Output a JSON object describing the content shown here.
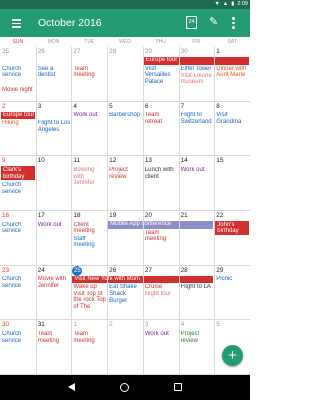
{
  "status_bar": {
    "time": "2:09",
    "battery_icon": "battery-icon",
    "wifi_icon": "wifi-icon",
    "signal_icon": "signal-icon"
  },
  "app_bar": {
    "title": "October 2016",
    "today_date": "24",
    "menu_icon": "menu-icon",
    "add_event_icon": "add-event-icon",
    "more_icon": "more-vert-icon"
  },
  "weekdays": [
    "SUN",
    "MON",
    "TUE",
    "WED",
    "THU",
    "FRI",
    "SAT"
  ],
  "colors": {
    "primary": "#249b74",
    "status": "#1f6b52",
    "red": "#d32f2f",
    "blue": "#1565c0",
    "green": "#2e7d32",
    "purple": "#7b1fa2",
    "orange": "#f4511e",
    "pink": "#e57373",
    "lavender": "#8e8ec9",
    "today": "#1a73c8"
  },
  "weeks": [
    {
      "days": [
        "25",
        "26",
        "27",
        "28",
        "29",
        "30",
        "1"
      ],
      "grey": [
        0,
        1,
        2,
        3,
        4,
        5
      ],
      "bars": [
        {
          "label": "Europe tour",
          "start": 4,
          "span": 3,
          "color": "red"
        }
      ],
      "events": [
        {
          "day": 0,
          "line": 0,
          "text": "Church service",
          "color": "blue"
        },
        {
          "day": 1,
          "line": 0,
          "text": "See a dentist",
          "color": "blue"
        },
        {
          "day": 2,
          "line": 0,
          "text": "Team meeting",
          "color": "red"
        },
        {
          "day": 4,
          "line": 0,
          "text": "Visit Versailles Palace",
          "color": "blue"
        },
        {
          "day": 5,
          "line": 0,
          "text": "Eiffel Tower",
          "color": "blue"
        },
        {
          "day": 5,
          "line": 1,
          "text": "Visit Louvre museum",
          "color": "pink"
        },
        {
          "day": 6,
          "line": 0,
          "text": "Dinner with Aunt Marie",
          "color": "orange"
        },
        {
          "day": 0,
          "line": 2,
          "text": "Movie night",
          "color": "red"
        }
      ]
    },
    {
      "days": [
        "2",
        "3",
        "4",
        "5",
        "6",
        "7",
        "8"
      ],
      "grey": [],
      "bars": [
        {
          "label": "Europe tour",
          "start": 0,
          "span": 1,
          "color": "red"
        }
      ],
      "events": [
        {
          "day": 0,
          "line": 0,
          "text": "Hiking",
          "color": "orange"
        },
        {
          "day": 1,
          "line": 0,
          "text": "Flight to Los Angeles",
          "color": "blue"
        },
        {
          "day": 2,
          "line": -1,
          "text": "Work out",
          "color": "purple"
        },
        {
          "day": 3,
          "line": -1,
          "text": "Barbershop",
          "color": "blue"
        },
        {
          "day": 4,
          "line": -1,
          "text": "Team retreat",
          "color": "red"
        },
        {
          "day": 5,
          "line": -1,
          "text": "Flight to Switzerland",
          "color": "blue"
        },
        {
          "day": 6,
          "line": -1,
          "text": "Visit Grandma",
          "color": "blue"
        }
      ]
    },
    {
      "days": [
        "9",
        "10",
        "11",
        "12",
        "13",
        "14",
        "15"
      ],
      "grey": [],
      "bars": [
        {
          "label": "Clark's birthday",
          "start": 0,
          "span": 1,
          "color": "red",
          "tall": true
        }
      ],
      "events": [
        {
          "day": 0,
          "line": 2,
          "text": "Church service",
          "color": "blue"
        },
        {
          "day": 2,
          "line": -1,
          "text": "Bowling with Jennifer",
          "color": "pink"
        },
        {
          "day": 3,
          "line": -1,
          "text": "Project review",
          "color": "red"
        },
        {
          "day": 4,
          "line": -1,
          "text": "Lunch with client",
          "color": "dark"
        },
        {
          "day": 5,
          "line": -1,
          "text": "Work out",
          "color": "purple"
        }
      ]
    },
    {
      "days": [
        "16",
        "17",
        "18",
        "19",
        "20",
        "21",
        "22"
      ],
      "grey": [],
      "bars": [
        {
          "label": "Mobile App conference",
          "start": 3,
          "span": 3,
          "color": "lavender"
        },
        {
          "label": "John's birthday",
          "start": 6,
          "span": 1,
          "color": "red",
          "tall": true
        }
      ],
      "events": [
        {
          "day": 0,
          "line": -1,
          "text": "Church service",
          "color": "blue"
        },
        {
          "day": 1,
          "line": -1,
          "text": "Work out",
          "color": "purple"
        },
        {
          "day": 2,
          "line": -1,
          "text": "Client meeting",
          "color": "red"
        },
        {
          "day": 2,
          "line": 1,
          "text": "Staff meeting",
          "color": "blue"
        },
        {
          "day": 4,
          "line": 1,
          "text": "Team meeting",
          "color": "red"
        }
      ]
    },
    {
      "days": [
        "23",
        "24",
        "25",
        "26",
        "27",
        "28",
        "29"
      ],
      "grey": [],
      "today_index": 2,
      "bars": [
        {
          "label": "Visit New York with Mom",
          "start": 2,
          "span": 4,
          "color": "red"
        }
      ],
      "events": [
        {
          "day": 0,
          "line": -1,
          "text": "Church service",
          "color": "blue"
        },
        {
          "day": 1,
          "line": -1,
          "text": "Movie with Jennifer",
          "color": "red"
        },
        {
          "day": 2,
          "line": 1,
          "text": "Wake up",
          "color": "red"
        },
        {
          "day": 2,
          "line": 2,
          "text": "Visit Top of the rock Top of The",
          "color": "red"
        },
        {
          "day": 3,
          "line": 1,
          "text": "Eat Shake Shack Burger",
          "color": "blue"
        },
        {
          "day": 4,
          "line": 1,
          "text": "Cruise",
          "color": "red"
        },
        {
          "day": 4,
          "line": 2,
          "text": "Night tour",
          "color": "pink"
        },
        {
          "day": 5,
          "line": 1,
          "text": "Flight to LA",
          "color": "dark"
        },
        {
          "day": 6,
          "line": -1,
          "text": "Picnic",
          "color": "blue"
        }
      ]
    },
    {
      "days": [
        "30",
        "31",
        "1",
        "2",
        "3",
        "4",
        "5"
      ],
      "grey": [
        2,
        3,
        4,
        5,
        6
      ],
      "bars": [],
      "events": [
        {
          "day": 0,
          "line": -1,
          "text": "Church service",
          "color": "blue"
        },
        {
          "day": 1,
          "line": -1,
          "text": "Team meeting",
          "color": "red"
        },
        {
          "day": 2,
          "line": -1,
          "text": "Team meeting",
          "color": "red"
        },
        {
          "day": 4,
          "line": -1,
          "text": "Work out",
          "color": "purple"
        },
        {
          "day": 5,
          "line": -1,
          "text": "Project review",
          "color": "green"
        }
      ]
    }
  ],
  "fab_icon": "plus-icon",
  "nav": {
    "back_icon": "back-icon",
    "home_icon": "home-icon",
    "recents_icon": "recents-icon"
  }
}
